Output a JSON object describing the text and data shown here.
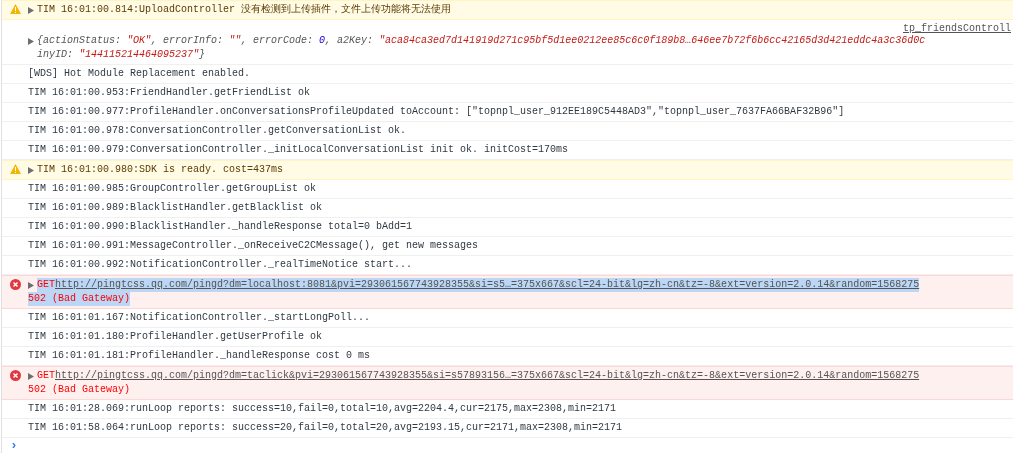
{
  "entries": [
    {
      "kind": "warning",
      "expandable": true,
      "text": "TIM 16:01:00.814:UploadController 没有检测到上传插件，文件上传功能将无法使用"
    },
    {
      "kind": "object",
      "expandable": true,
      "source": "tp_friendsControll",
      "lines": [
        [
          {
            "kind": "plain",
            "text": "{actionStatus: "
          },
          {
            "kind": "string",
            "text": "\"OK\""
          },
          {
            "kind": "plain",
            "text": ", errorInfo: "
          },
          {
            "kind": "string",
            "text": "\"\""
          },
          {
            "kind": "plain",
            "text": ", errorCode: "
          },
          {
            "kind": "number",
            "text": "0"
          },
          {
            "kind": "plain",
            "text": ", a2Key: "
          },
          {
            "kind": "string",
            "text": "\"aca84ca3ed7d141919d271c95bf5d1ee0212ee85c6c0f189b8…646ee7b72f6b6cc42165d3d421eddc4a3c36d0c"
          }
        ],
        [
          {
            "kind": "plain",
            "text": "inyID: "
          },
          {
            "kind": "string",
            "text": "\"144115214464095237\""
          },
          {
            "kind": "plain",
            "text": "}"
          }
        ]
      ]
    },
    {
      "kind": "log",
      "text": "[WDS] Hot Module Replacement enabled."
    },
    {
      "kind": "log",
      "text": "TIM 16:01:00.953:FriendHandler.getFriendList ok"
    },
    {
      "kind": "log",
      "text": "TIM 16:01:00.977:ProfileHandler.onConversationsProfileUpdated toAccount: [\"topnpl_user_912EE189C5448AD3\",\"topnpl_user_7637FA66BAF32B96\"]"
    },
    {
      "kind": "log",
      "text": "TIM 16:01:00.978:ConversationController.getConversationList ok."
    },
    {
      "kind": "log",
      "text": "TIM 16:01:00.979:ConversationController._initLocalConversationList init ok. initCost=170ms"
    },
    {
      "kind": "warning",
      "expandable": true,
      "text": "TIM 16:01:00.980:SDK is ready. cost=437ms"
    },
    {
      "kind": "log",
      "text": "TIM 16:01:00.985:GroupController.getGroupList ok"
    },
    {
      "kind": "log",
      "text": "TIM 16:01:00.989:BlacklistHandler.getBlacklist ok"
    },
    {
      "kind": "log",
      "text": "TIM 16:01:00.990:BlacklistHandler._handleResponse total=0 bAdd=1"
    },
    {
      "kind": "log",
      "text": "TIM 16:01:00.991:MessageController._onReceiveC2CMessage(), get new messages"
    },
    {
      "kind": "log",
      "text": "TIM 16:01:00.992:NotificationController._realTimeNotice start..."
    },
    {
      "kind": "error",
      "expandable": true,
      "highlighted": true,
      "method": "GET",
      "url": "http://pingtcss.qq.com/pingd?dm=localhost:8081&pvi=293061567743928355&si=s5…=375x667&scl=24-bit&lg=zh-cn&tz=-8&ext=version=2.0.14&random=1568275",
      "status": "502 (Bad Gateway)"
    },
    {
      "kind": "log",
      "text": "TIM 16:01:01.167:NotificationController._startLongPoll..."
    },
    {
      "kind": "log",
      "text": "TIM 16:01:01.180:ProfileHandler.getUserProfile ok"
    },
    {
      "kind": "log",
      "text": "TIM 16:01:01.181:ProfileHandler._handleResponse cost 0 ms"
    },
    {
      "kind": "error",
      "expandable": true,
      "highlighted": false,
      "method": "GET",
      "url": "http://pingtcss.qq.com/pingd?dm=taclick&pvi=293061567743928355&si=s57893156…=375x667&scl=24-bit&lg=zh-cn&tz=-8&ext=version=2.0.14&random=1568275",
      "status": "502 (Bad Gateway)"
    },
    {
      "kind": "log",
      "text": "TIM 16:01:28.069:runLoop reports: success=10,fail=0,total=10,avg=2204.4,cur=2175,max=2308,min=2171"
    },
    {
      "kind": "log",
      "text": "TIM 16:01:58.064:runLoop reports: success=20,fail=0,total=20,avg=2193.15,cur=2171,max=2308,min=2171"
    }
  ],
  "prompt": {
    "symbol": "›"
  }
}
